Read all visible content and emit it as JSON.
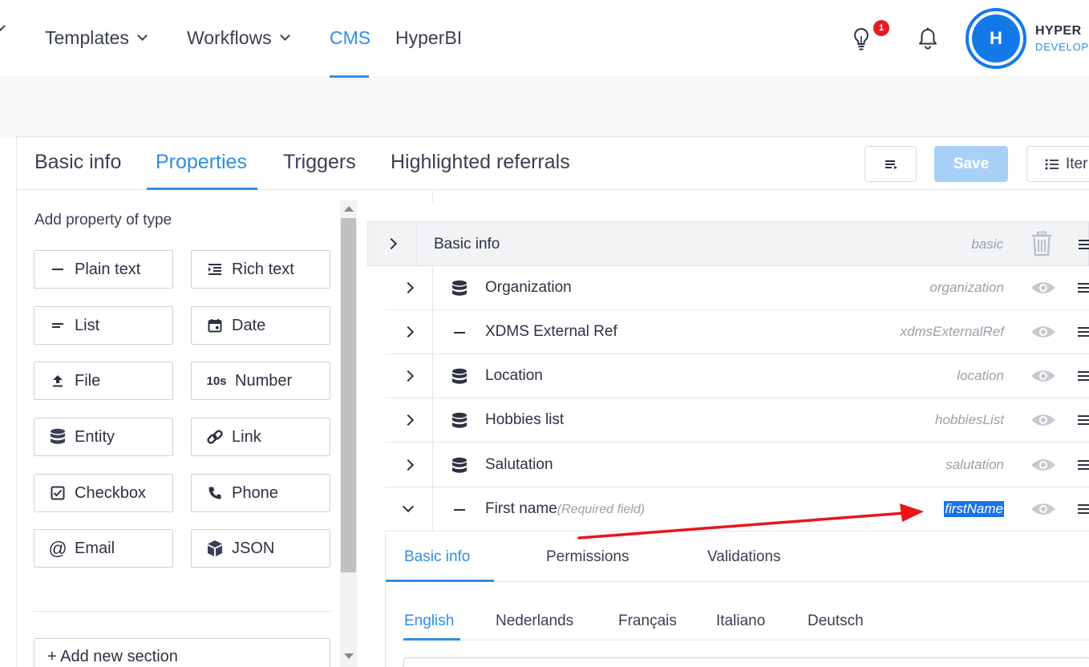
{
  "nav": {
    "items": [
      {
        "label": "",
        "has_chevron": true
      },
      {
        "label": "Templates",
        "has_chevron": true
      },
      {
        "label": "Workflows",
        "has_chevron": true
      },
      {
        "label": "CMS",
        "has_chevron": false,
        "active": true
      },
      {
        "label": "HyperBI",
        "has_chevron": false
      }
    ],
    "notification_count": "1",
    "user": {
      "initial": "H",
      "name": "HYPER",
      "role": "DEVELOP"
    }
  },
  "tabs": {
    "items": [
      "Basic info",
      "Properties",
      "Triggers",
      "Highlighted referrals"
    ],
    "active": "Properties"
  },
  "toolbar": {
    "save_label": "Save",
    "items_label": "Iter"
  },
  "left_panel": {
    "title": "Add property of type",
    "types": [
      {
        "label": "Plain text",
        "icon": "minus-icon"
      },
      {
        "label": "Rich text",
        "icon": "rich-text-icon"
      },
      {
        "label": "List",
        "icon": "list-icon"
      },
      {
        "label": "Date",
        "icon": "calendar-icon"
      },
      {
        "label": "File",
        "icon": "upload-icon"
      },
      {
        "label": "Number",
        "icon": "number-icon",
        "icon_text": "10s"
      },
      {
        "label": "Entity",
        "icon": "database-icon"
      },
      {
        "label": "Link",
        "icon": "link-icon"
      },
      {
        "label": "Checkbox",
        "icon": "checkbox-icon"
      },
      {
        "label": "Phone",
        "icon": "phone-icon"
      },
      {
        "label": "Email",
        "icon": "at-icon",
        "icon_text": "@"
      },
      {
        "label": "JSON",
        "icon": "cube-icon"
      }
    ],
    "add_section_label": "+ Add new section"
  },
  "section": {
    "title": "Basic info",
    "key": "basic"
  },
  "properties": [
    {
      "label": "Organization",
      "key": "organization",
      "icon": "database-icon",
      "expanded": false
    },
    {
      "label": "XDMS External Ref",
      "key": "xdmsExternalRef",
      "icon": "minus-icon",
      "expanded": false
    },
    {
      "label": "Location",
      "key": "location",
      "icon": "database-icon",
      "expanded": false
    },
    {
      "label": "Hobbies list",
      "key": "hobbiesList",
      "icon": "database-icon",
      "expanded": false
    },
    {
      "label": "Salutation",
      "key": "salutation",
      "icon": "database-icon",
      "expanded": false
    },
    {
      "label": "First name",
      "required": "(Required field)",
      "key": "firstName",
      "icon": "minus-icon",
      "expanded": true,
      "key_selected": true
    }
  ],
  "expanded_property": {
    "subtabs": [
      "Basic info",
      "Permissions",
      "Validations"
    ],
    "active_subtab": "Basic info",
    "languages": [
      "English",
      "Nederlands",
      "Français",
      "Italiano",
      "Deutsch"
    ],
    "active_language": "English"
  },
  "colors": {
    "accent": "#2f8ee6",
    "save_disabled": "#a8d0f7",
    "selection": "#1a73e8",
    "annotation_arrow": "#e8161b",
    "badge": "#e51b23"
  }
}
